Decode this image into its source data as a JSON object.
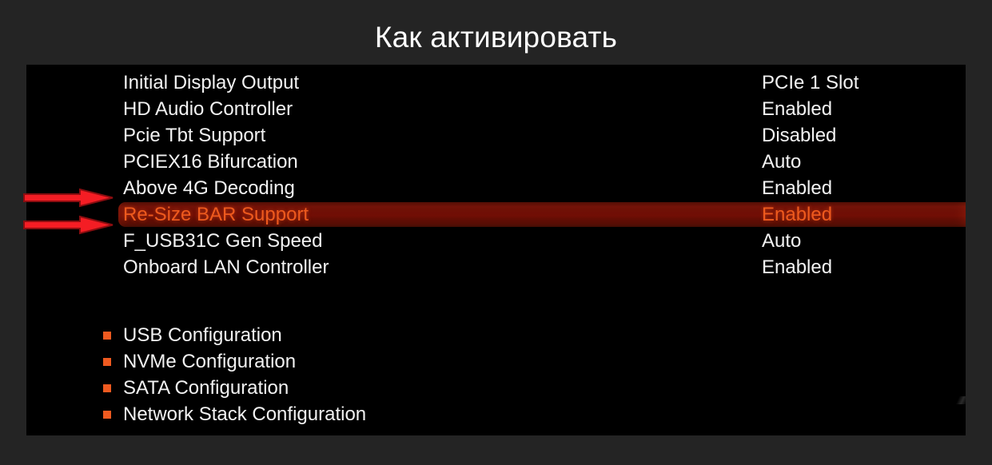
{
  "page": {
    "title": "Как активировать",
    "background_color": "#242424"
  },
  "bios": {
    "panel_background": "#000000",
    "text_color": "#f2f2f2",
    "highlight_background": "#6d1008",
    "highlight_text_color": "#ee5a1e",
    "bullet_color": "#ef5a20",
    "settings": [
      {
        "label": "Initial Display Output",
        "value": "PCIe 1 Slot",
        "selected": false
      },
      {
        "label": "HD Audio Controller",
        "value": "Enabled",
        "selected": false
      },
      {
        "label": "Pcie Tbt Support",
        "value": "Disabled",
        "selected": false
      },
      {
        "label": "PCIEX16 Bifurcation",
        "value": "Auto",
        "selected": false
      },
      {
        "label": "Above 4G Decoding",
        "value": "Enabled",
        "selected": false
      },
      {
        "label": "Re-Size BAR Support",
        "value": "Enabled",
        "selected": true
      },
      {
        "label": "F_USB31C Gen Speed",
        "value": "Auto",
        "selected": false
      },
      {
        "label": "Onboard LAN Controller",
        "value": "Enabled",
        "selected": false
      }
    ],
    "submenus": [
      {
        "label": "USB Configuration"
      },
      {
        "label": "NVMe Configuration"
      },
      {
        "label": "SATA Configuration"
      },
      {
        "label": "Network Stack Configuration"
      }
    ]
  },
  "annotations": {
    "arrow_color": "#f41d24",
    "arrow_outline_color": "#8c0d10",
    "arrows": [
      {
        "points_to": "Above 4G Decoding"
      },
      {
        "points_to": "Re-Size BAR Support"
      }
    ]
  }
}
